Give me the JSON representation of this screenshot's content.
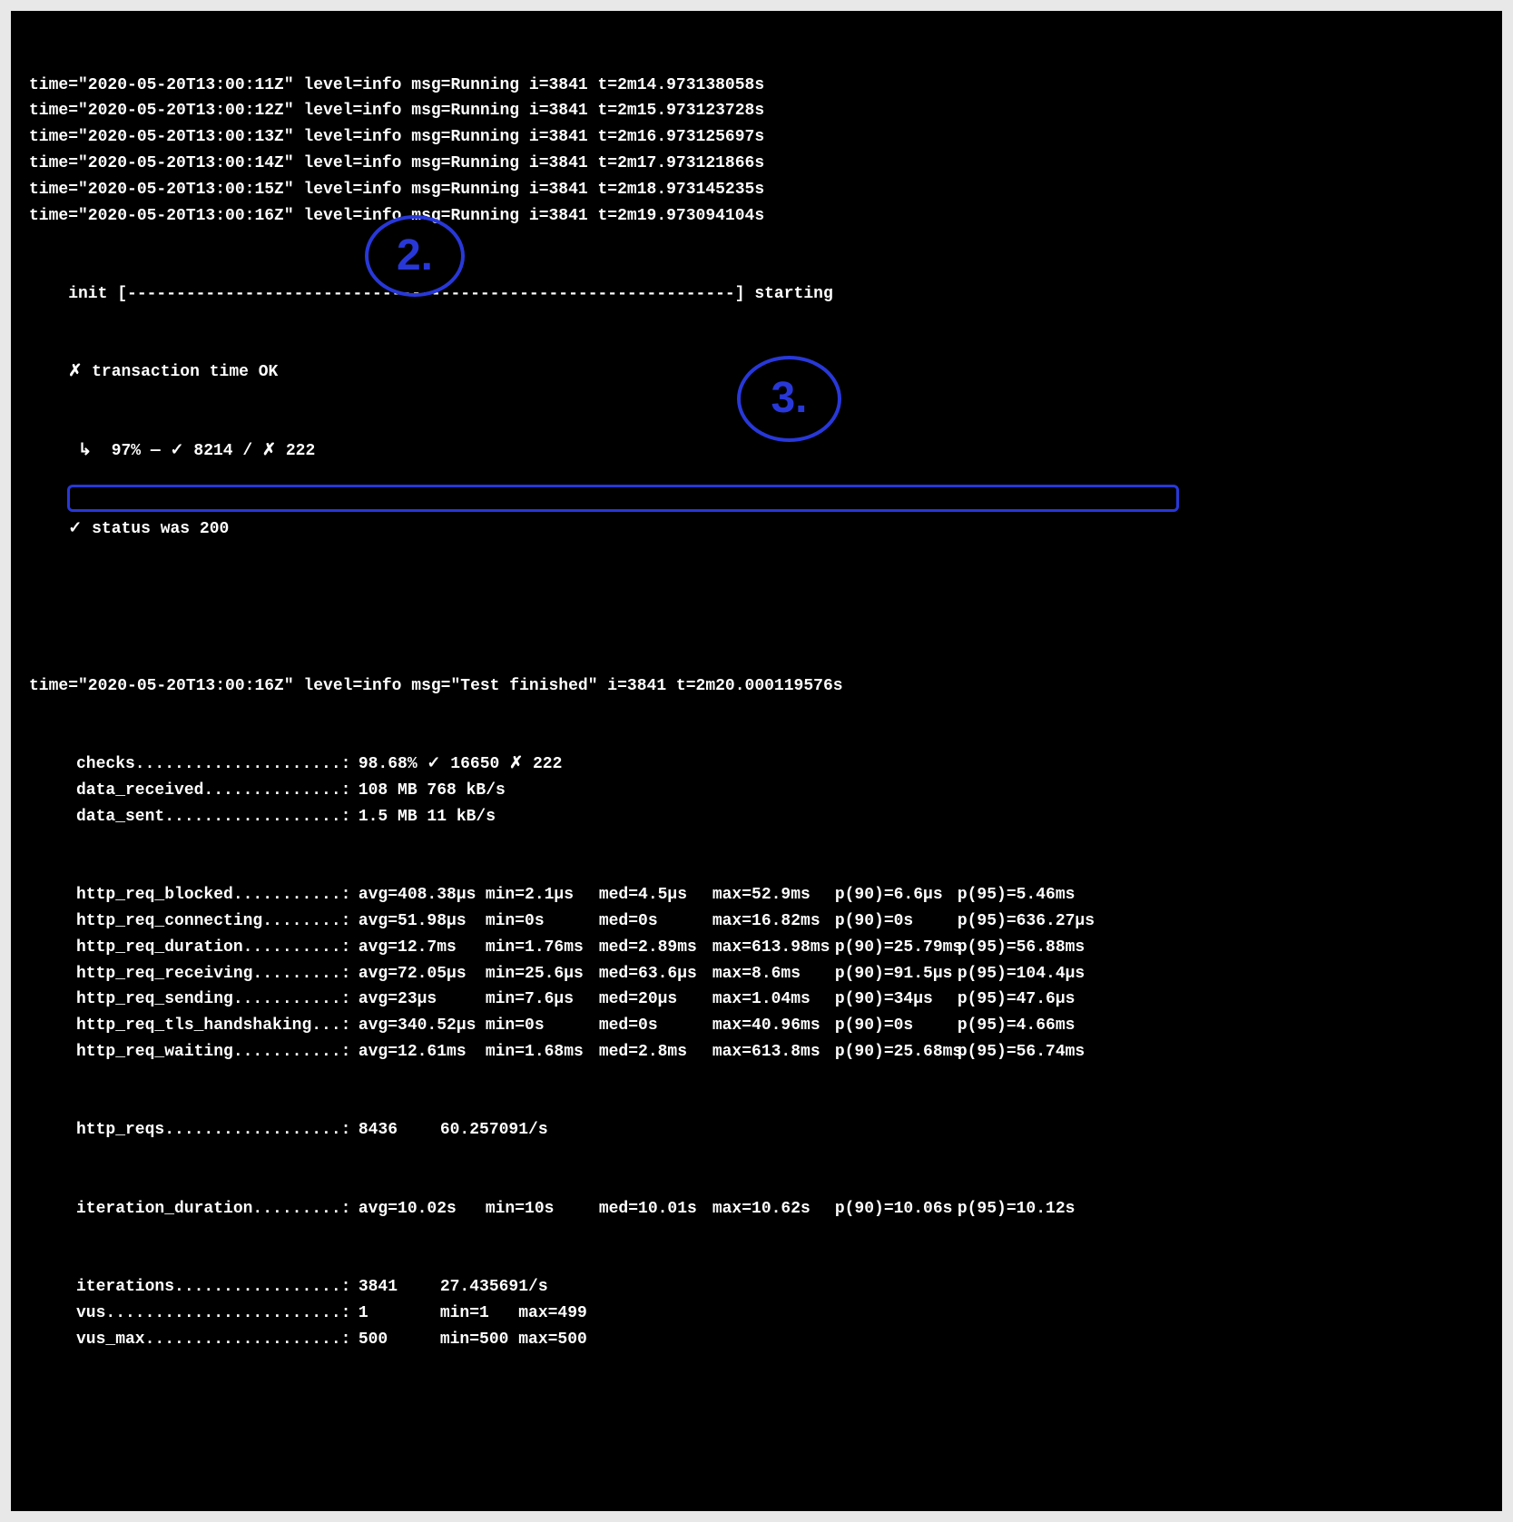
{
  "running_logs": [
    {
      "time": "2020-05-20T13:00:11Z",
      "level": "info",
      "msg": "Running",
      "i": "3841",
      "t": "2m14.973138058s"
    },
    {
      "time": "2020-05-20T13:00:12Z",
      "level": "info",
      "msg": "Running",
      "i": "3841",
      "t": "2m15.973123728s"
    },
    {
      "time": "2020-05-20T13:00:13Z",
      "level": "info",
      "msg": "Running",
      "i": "3841",
      "t": "2m16.973125697s"
    },
    {
      "time": "2020-05-20T13:00:14Z",
      "level": "info",
      "msg": "Running",
      "i": "3841",
      "t": "2m17.973121866s"
    },
    {
      "time": "2020-05-20T13:00:15Z",
      "level": "info",
      "msg": "Running",
      "i": "3841",
      "t": "2m18.973145235s"
    },
    {
      "time": "2020-05-20T13:00:16Z",
      "level": "info",
      "msg": "Running",
      "i": "3841",
      "t": "2m19.973094104s"
    }
  ],
  "init_line": "    init [--------------------------------------------------------------] starting",
  "checks_block": {
    "fail_line": "    ✗ transaction time OK",
    "arrow_line": "     ↳  97% — ✓ 8214 / ✗ 222",
    "pass_line": "    ✓ status was 200"
  },
  "finished_log": {
    "time": "2020-05-20T13:00:16Z",
    "level": "info",
    "msg": "\"Test finished\"",
    "i": "3841",
    "t": "2m20.000119576s"
  },
  "annotations": {
    "two": "2.",
    "three": "3."
  },
  "simple_metrics": [
    {
      "name": "checks.....................:",
      "value": "98.68% ✓ 16650 ✗ 222"
    },
    {
      "name": "data_received..............:",
      "value": "108 MB 768 kB/s"
    },
    {
      "name": "data_sent..................:",
      "value": "1.5 MB 11 kB/s"
    }
  ],
  "stat_metrics": [
    {
      "name": "http_req_blocked...........:",
      "avg": "avg=408.38µs",
      "min": "min=2.1µs",
      "med": "med=4.5µs",
      "max": "max=52.9ms",
      "p90": "p(90)=6.6µs",
      "p95": "p(95)=5.46ms",
      "hl": false
    },
    {
      "name": "http_req_connecting........:",
      "avg": "avg=51.98µs",
      "min": "min=0s",
      "med": "med=0s",
      "max": "max=16.82ms",
      "p90": "p(90)=0s",
      "p95": "p(95)=636.27µs",
      "hl": false
    },
    {
      "name": "http_req_duration..........:",
      "avg": "avg=12.7ms",
      "min": "min=1.76ms",
      "med": "med=2.89ms",
      "max": "max=613.98ms",
      "p90": "p(90)=25.79ms",
      "p95": "p(95)=56.88ms",
      "hl": true
    },
    {
      "name": "http_req_receiving.........:",
      "avg": "avg=72.05µs",
      "min": "min=25.6µs",
      "med": "med=63.6µs",
      "max": "max=8.6ms",
      "p90": "p(90)=91.5µs",
      "p95": "p(95)=104.4µs",
      "hl": false
    },
    {
      "name": "http_req_sending...........:",
      "avg": "avg=23µs",
      "min": "min=7.6µs",
      "med": "med=20µs",
      "max": "max=1.04ms",
      "p90": "p(90)=34µs",
      "p95": "p(95)=47.6µs",
      "hl": false
    },
    {
      "name": "http_req_tls_handshaking...:",
      "avg": "avg=340.52µs",
      "min": "min=0s",
      "med": "med=0s",
      "max": "max=40.96ms",
      "p90": "p(90)=0s",
      "p95": "p(95)=4.66ms",
      "hl": false
    },
    {
      "name": "http_req_waiting...........:",
      "avg": "avg=12.61ms",
      "min": "min=1.68ms",
      "med": "med=2.8ms",
      "max": "max=613.8ms",
      "p90": "p(90)=25.68ms",
      "p95": "p(95)=56.74ms",
      "hl": false
    }
  ],
  "rate_metrics": [
    {
      "name": "http_reqs..................:",
      "v1": "8436",
      "v2": "60.257091/s"
    }
  ],
  "iter_metric": {
    "name": "iteration_duration.........:",
    "avg": "avg=10.02s",
    "min": "min=10s",
    "med": "med=10.01s",
    "max": "max=10.62s",
    "p90": "p(90)=10.06s",
    "p95": "p(95)=10.12s"
  },
  "tail_metrics": [
    {
      "name": "iterations.................:",
      "v1": "3841",
      "v2": "27.435691/s"
    },
    {
      "name": "vus........................:",
      "v1": "1",
      "v2": "min=1   max=499"
    },
    {
      "name": "vus_max....................:",
      "v1": "500",
      "v2": "min=500 max=500"
    }
  ]
}
